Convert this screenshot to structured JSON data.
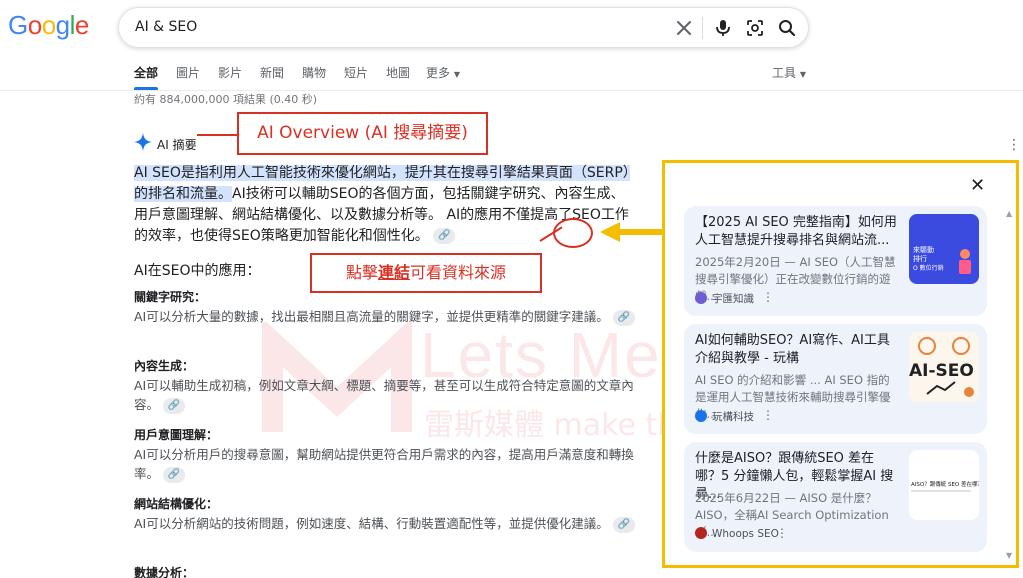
{
  "header": {
    "logo_text": "Google",
    "query": "AI & SEO",
    "icons": [
      "clear-icon",
      "microphone-icon",
      "lens-icon",
      "search-icon"
    ]
  },
  "tabs": {
    "items": [
      "全部",
      "圖片",
      "影片",
      "新聞",
      "購物",
      "短片",
      "地圖"
    ],
    "more": "更多",
    "tools": "工具"
  },
  "stats": "約有 884,000,000 項結果 (0.40 秒)",
  "watermark": {
    "brand": "Lets Media",
    "tagline": "雷斯媒體 make things better"
  },
  "ai_overview": {
    "label": "AI 摘要",
    "summary_highlight": "AI SEO是指利用人工智能技術來優化網站，提升其在搜尋引擎結果頁面（SERP）的排名和流量。",
    "summary_rest": "AI技術可以輔助SEO的各個方面，包括關鍵字研究、內容生成、用戶意圖理解、網站結構優化、以及數據分析等。 AI的應用不僅提高了SEO工作的效率，也使得SEO策略更加智能化和個性化。",
    "subheading": "AI在SEO中的應用：",
    "sections": [
      {
        "title": "關鍵字研究：",
        "body": "AI可以分析大量的數據，找出最相關且高流量的關鍵字，並提供更精準的關鍵字建議。"
      },
      {
        "title": "內容生成：",
        "body": "AI可以輔助生成初稿，例如文章大綱、標題、摘要等，甚至可以生成符合特定意圖的文章內容。"
      },
      {
        "title": "用戶意圖理解：",
        "body": "AI可以分析用戶的搜尋意圖，幫助網站提供更符合用戶需求的內容，提高用戶滿意度和轉換率。"
      },
      {
        "title": "網站結構優化：",
        "body": "AI可以分析網站的技術問題，例如速度、結構、行動裝置適配性等，並提供優化建議。"
      },
      {
        "title": "數據分析：",
        "body": ""
      }
    ]
  },
  "annotations": {
    "callout_overview": "AI Overview (AI 搜尋摘要)",
    "callout_link_pre": "點擊",
    "callout_link_bold": "連結",
    "callout_link_post": "可看資料來源"
  },
  "sources_panel": {
    "cards": [
      {
        "title": "【2025 AI SEO 完整指南】如何用人工智慧提升搜尋排名與網站流...",
        "snippet": "2025年2月20日 — AI SEO（人工智慧搜尋引擎優化）正在改變數位行銷的遊戲...",
        "source": "宇匯知識",
        "thumb_text": "來驅動\n排行\nO 數位行銷",
        "thumb_color": "#3b4be0"
      },
      {
        "title": "AI如何輔助SEO？AI寫作、AI工具介紹與教學 - 玩構",
        "snippet": "AI SEO 的介紹和影響 ... AI SEO 指的是運用人工智慧技術來輔助搜尋引擎優化...",
        "source": "玩構科技",
        "thumb_text": "AI-SEO",
        "thumb_color": "#fdf6ec"
      },
      {
        "title": "什麼是AISO？跟傳統SEO 差在哪？5 分鐘懶人包，輕鬆掌握AI 搜尋...",
        "snippet": "2025年6月22日 — AISO 是什麼？AISO，全稱AI Search Optimization（...",
        "source": "Whoops SEO",
        "thumb_text": "AISO？跟傳統 SEO 差在哪？",
        "thumb_color": "#ffffff"
      }
    ]
  },
  "colors": {
    "annotation_red": "#d93025",
    "panel_border": "#f5bd00",
    "link_blue": "#1a73e8",
    "highlight": "#d3e3fd"
  }
}
